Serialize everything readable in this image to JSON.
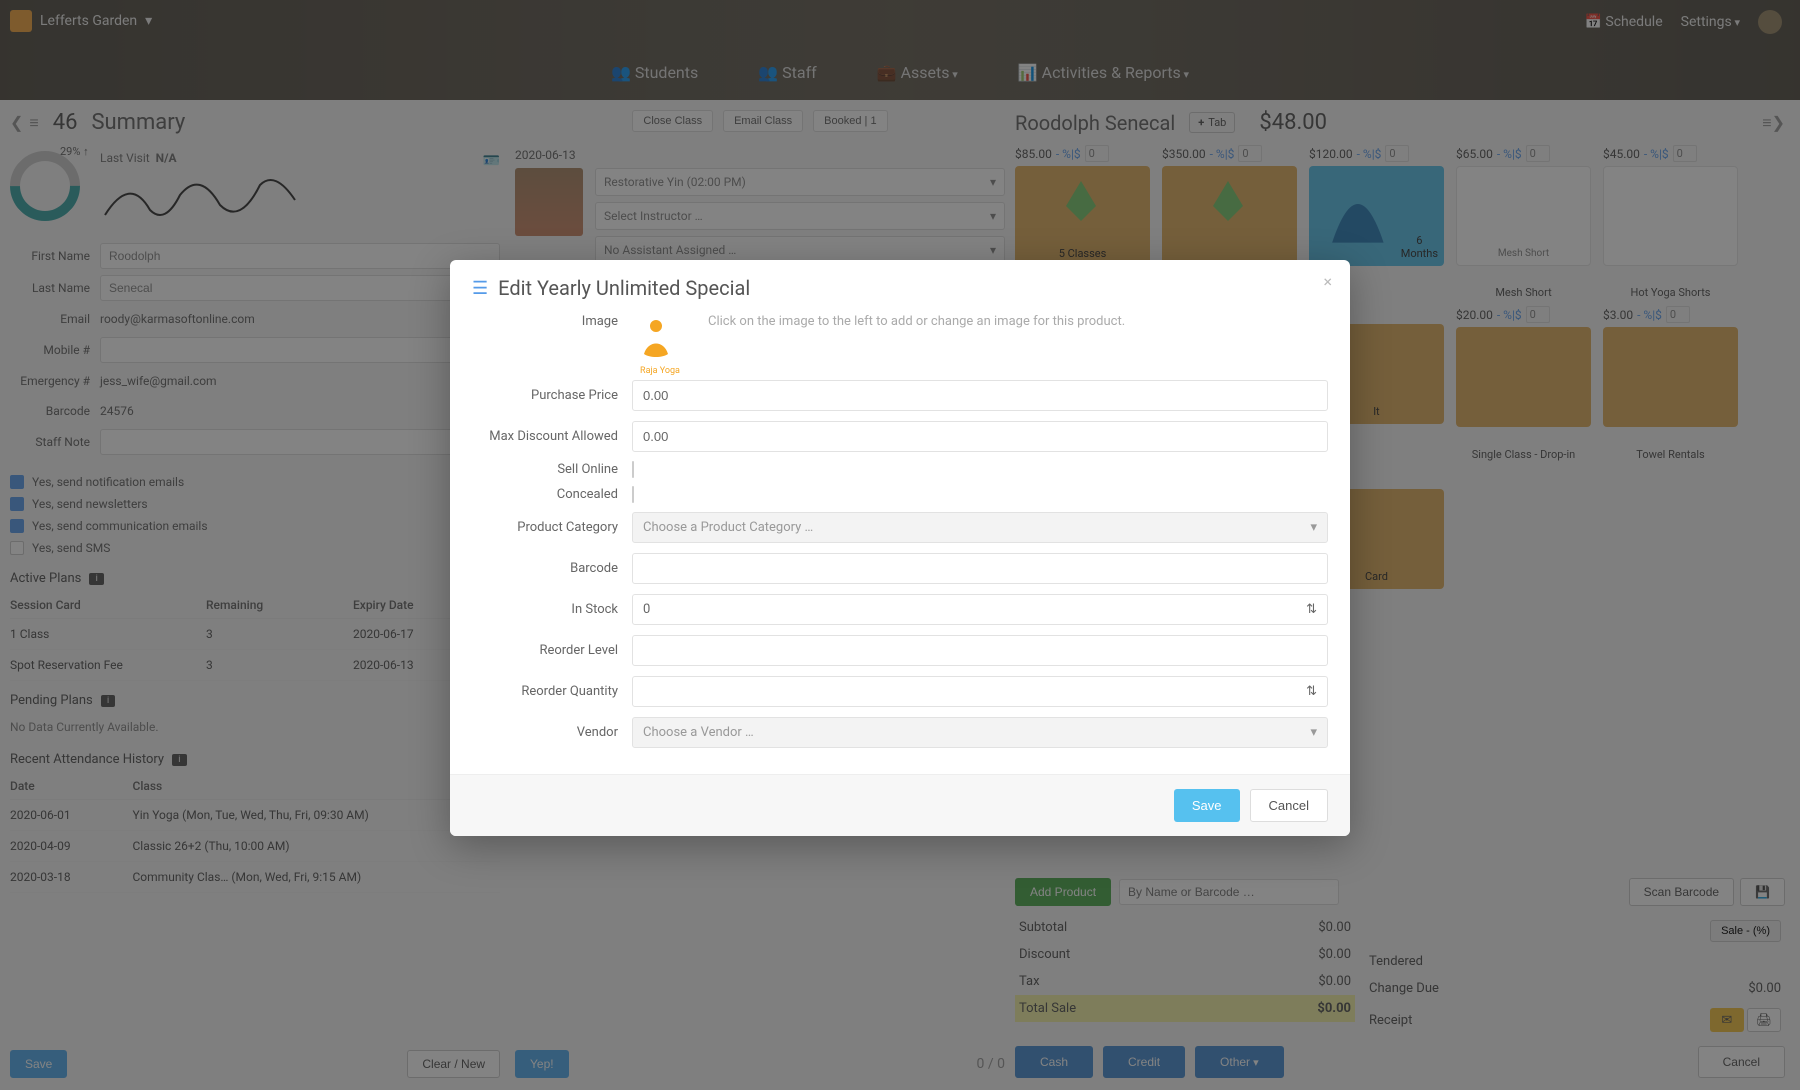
{
  "topbar": {
    "location": "Lefferts Garden",
    "nav": {
      "students": "Students",
      "staff": "Staff",
      "assets": "Assets",
      "activities": "Activities & Reports"
    },
    "schedule": "Schedule",
    "settings": "Settings"
  },
  "left": {
    "count": "46",
    "summary": "Summary",
    "pct": "29%",
    "last_visit_label": "Last Visit",
    "last_visit_val": "N/A",
    "fields": {
      "first_name_label": "First Name",
      "first_name": "Roodolph",
      "last_name_label": "Last Name",
      "last_name": "Senecal",
      "email_label": "Email",
      "email": "roody@karmasoftonline.com",
      "mobile_label": "Mobile #",
      "mobile": "",
      "emergency_label": "Emergency #",
      "emergency": "jess_wife@gmail.com",
      "barcode_label": "Barcode",
      "barcode": "24576",
      "staffnote_label": "Staff Note",
      "staffnote": ""
    },
    "checks": {
      "notif": "Yes, send notification emails",
      "news": "Yes, send newsletters",
      "comm": "Yes, send communication emails",
      "sms": "Yes, send SMS"
    },
    "active_plans": "Active Plans",
    "plans_head": {
      "c1": "Session Card",
      "c2": "Remaining",
      "c3": "Expiry Date"
    },
    "plans": [
      {
        "c1": "1 Class",
        "c2": "3",
        "c3": "2020-06-17"
      },
      {
        "c1": "Spot Reservation Fee",
        "c2": "3",
        "c3": "2020-06-13"
      }
    ],
    "pending_plans": "Pending Plans",
    "pending_msg": "No Data Currently Available.",
    "attendance": "Recent Attendance History",
    "att_head": {
      "c1": "Date",
      "c2": "Class"
    },
    "att": [
      {
        "c1": "2020-06-01",
        "c2": "Yin Yoga (Mon, Tue, Wed, Thu, Fri, 09:30 AM)"
      },
      {
        "c1": "2020-04-09",
        "c2": "Classic 26+2 (Thu, 10:00 AM)"
      },
      {
        "c1": "2020-03-18",
        "c2": "Community Clas… (Mon, Wed, Fri, 9:15 AM)"
      }
    ],
    "save": "Save",
    "clear": "Clear / New"
  },
  "mid": {
    "btns": {
      "close": "Close Class",
      "email": "Email Class",
      "booked": "Booked | 1"
    },
    "date": "2020-06-13",
    "class": "Restorative Yin (02:00 PM)",
    "instructor": "Select Instructor …",
    "assistant": "No Assistant Assigned …",
    "yep": "Yep!",
    "count": "0 / 0"
  },
  "right": {
    "name": "Roodolph Senecal",
    "tab": "Tab",
    "amount": "$48.00",
    "row1": [
      {
        "price": "$85.00",
        "badge": "- %|$",
        "qty": "0",
        "label": "5 Classes",
        "tile": "green"
      },
      {
        "price": "$350.00",
        "badge": "- %|$",
        "qty": "0",
        "label": "",
        "tile": "green"
      },
      {
        "price": "$120.00",
        "badge": "- %|$",
        "qty": "0",
        "label": "6 Months",
        "tile": "blue"
      },
      {
        "price": "$65.00",
        "badge": "- %|$",
        "qty": "0",
        "label": "Mesh Short",
        "tile": "white",
        "below": true
      },
      {
        "price": "$45.00",
        "badge": "- %|$",
        "qty": "0",
        "label": "Hot Yoga Shorts",
        "tile": "white",
        "below": true
      }
    ],
    "row2": [
      {
        "label": "lt",
        "tile": "tan"
      },
      {
        "price": "$20.00",
        "badge": "- %|$",
        "qty": "0",
        "label": "Single Class - Drop-in",
        "tile": "tan",
        "below": true
      },
      {
        "price": "$3.00",
        "badge": "- %|$",
        "qty": "0",
        "label": "Towel Rentals",
        "tile": "tan",
        "below": true
      }
    ],
    "row3_label": "Card",
    "add_product": "Add Product",
    "search_placeholder": "By Name or Barcode …",
    "scan": "Scan Barcode",
    "totals": {
      "subtotal_l": "Subtotal",
      "subtotal": "$0.00",
      "discount_l": "Discount",
      "discount": "$0.00",
      "tax_l": "Tax",
      "tax": "$0.00",
      "total_l": "Total Sale",
      "total": "$0.00",
      "sale_btn": "Sale - (%)",
      "tendered_l": "Tendered",
      "tendered": "",
      "change_l": "Change Due",
      "change": "$0.00",
      "receipt_l": "Receipt"
    },
    "pay": {
      "cash": "Cash",
      "credit": "Credit",
      "other": "Other",
      "cancel": "Cancel"
    }
  },
  "modal": {
    "title": "Edit Yearly Unlimited Special",
    "image_l": "Image",
    "image_hint": "Click on the image to the left to add or change an image for this product.",
    "logo_text": "Raja Yoga",
    "price_l": "Purchase Price",
    "price": "0.00",
    "maxdisc_l": "Max Discount Allowed",
    "maxdisc": "0.00",
    "sellonline_l": "Sell Online",
    "concealed_l": "Concealed",
    "category_l": "Product Category",
    "category_ph": "Choose a Product Category …",
    "barcode_l": "Barcode",
    "instock_l": "In Stock",
    "instock": "0",
    "reorderlvl_l": "Reorder Level",
    "reorderqty_l": "Reorder Quantity",
    "vendor_l": "Vendor",
    "vendor_ph": "Choose a Vendor …",
    "save": "Save",
    "cancel": "Cancel"
  }
}
